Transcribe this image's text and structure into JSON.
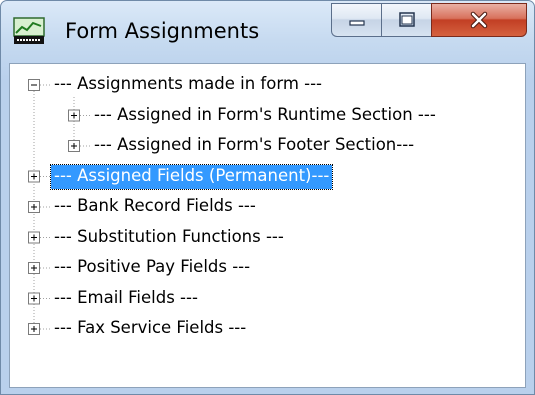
{
  "window": {
    "title": "Form Assignments",
    "app_icon": "form-grid-icon"
  },
  "caption_buttons": {
    "minimize": "minimize-icon",
    "maximize": "maximize-icon",
    "close": "close-icon"
  },
  "colors": {
    "selection": "#3399ff",
    "tree_lines": "#a0a0a0",
    "close_button": "#c94a32"
  },
  "tree": {
    "nodes": [
      {
        "label": "--- Assignments made in form ---",
        "level": 0,
        "expanded": true,
        "selected": false
      },
      {
        "label": "--- Assigned in Form's Runtime Section  ---",
        "level": 1,
        "expanded": false,
        "selected": false
      },
      {
        "label": "--- Assigned in Form's Footer Section---",
        "level": 1,
        "expanded": false,
        "selected": false
      },
      {
        "label": "--- Assigned Fields (Permanent)---",
        "level": 0,
        "expanded": false,
        "selected": true
      },
      {
        "label": "--- Bank Record Fields ---",
        "level": 0,
        "expanded": false,
        "selected": false
      },
      {
        "label": "--- Substitution Functions ---",
        "level": 0,
        "expanded": false,
        "selected": false
      },
      {
        "label": "--- Positive Pay Fields ---",
        "level": 0,
        "expanded": false,
        "selected": false
      },
      {
        "label": "--- Email Fields ---",
        "level": 0,
        "expanded": false,
        "selected": false
      },
      {
        "label": "--- Fax Service Fields ---",
        "level": 0,
        "expanded": false,
        "selected": false
      }
    ]
  }
}
